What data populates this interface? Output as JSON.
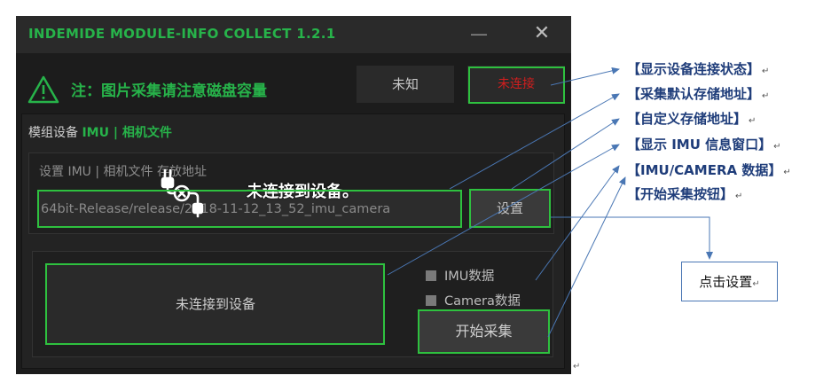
{
  "window": {
    "title": "INDEMIDE MODULE-INFO COLLECT 1.2.1",
    "minimize_glyph": "—",
    "close_glyph": "✕"
  },
  "notice": {
    "text": "注：图片采集请注意磁盘容量",
    "icon": "warning-icon"
  },
  "status": {
    "unknown_label": "未知",
    "connection_label": "未连接"
  },
  "module": {
    "label_prefix": "模组设备 ",
    "label_highlight": "IMU | 相机文件"
  },
  "storage": {
    "label": "设置 IMU | 相机文件 存放地址",
    "path_value": "64bit-Release/release/2018-11-12_13_52_imu_camera",
    "set_button": "设置"
  },
  "imu_panel": {
    "info_text": "未连接到设备",
    "imu_checkbox": "IMU数据",
    "camera_checkbox": "Camera数据",
    "start_button": "开始采集"
  },
  "overlay": {
    "message": "未连接到设备。",
    "icon": "unplugged-icon"
  },
  "annotations": {
    "items": [
      "【显示设备连接状态】",
      "【采集默认存储地址】",
      "【自定义存储地址】",
      "【显示 IMU 信息窗口】",
      "【IMU/CAMERA 数据】",
      "【开始采集按钮】"
    ],
    "paragraph_mark": "↵",
    "click_label": "点击设置"
  },
  "colors": {
    "accent_green": "#27b34a",
    "error_red": "#d11e1e",
    "annotation_blue": "#1f3d7a",
    "arrow_blue": "#4a77b4"
  }
}
